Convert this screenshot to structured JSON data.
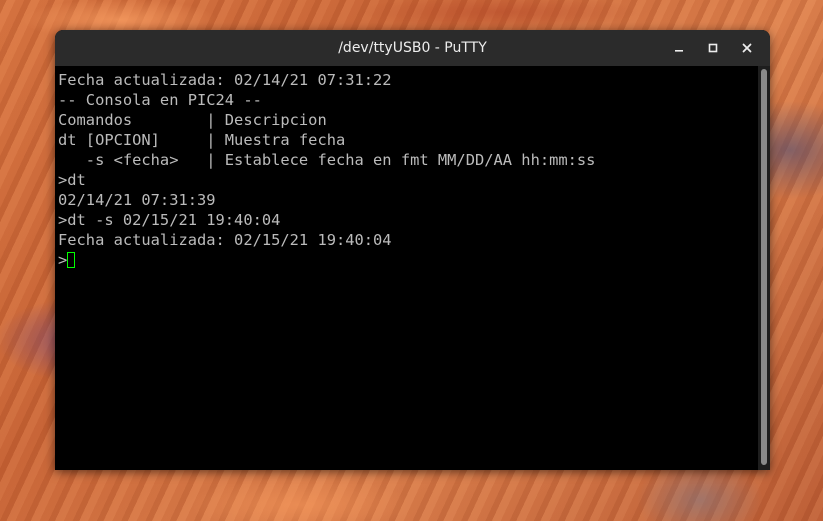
{
  "window": {
    "title": "/dev/ttyUSB0 - PuTTY"
  },
  "controls": {
    "minimize_icon": "minimize-icon",
    "maximize_icon": "maximize-icon",
    "close_icon": "close-icon"
  },
  "terminal": {
    "lines": [
      "Fecha actualizada: 02/14/21 07:31:22",
      "-- Consola en PIC24 --",
      "Comandos        | Descripcion",
      "dt [OPCION]     | Muestra fecha",
      "   -s <fecha>   | Establece fecha en fmt MM/DD/AA hh:mm:ss",
      ">dt",
      "02/14/21 07:31:39",
      ">dt -s 02/15/21 19:40:04",
      "Fecha actualizada: 02/15/21 19:40:04"
    ],
    "prompt": ">",
    "cursor_color": "#00ff00",
    "text_color": "#bbbbbb"
  }
}
